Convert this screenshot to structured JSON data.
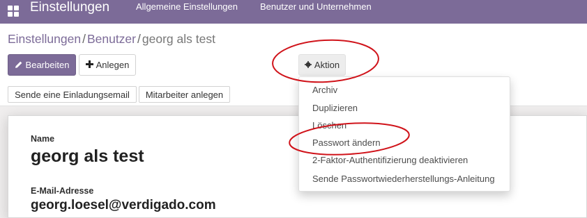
{
  "header": {
    "app_title": "Einstellungen",
    "menu": [
      {
        "label": "Allgemeine Einstellungen"
      },
      {
        "label": "Benutzer und Unternehmen"
      }
    ]
  },
  "breadcrumb": {
    "items": [
      "Einstellungen",
      "Benutzer"
    ],
    "separator": "/",
    "current": "georg als test"
  },
  "toolbar": {
    "edit_label": "Bearbeiten",
    "create_label": "Anlegen",
    "action_label": "Aktion"
  },
  "action_menu": {
    "items": [
      {
        "label": "Archiv"
      },
      {
        "label": "Duplizieren"
      },
      {
        "label": "Löschen"
      },
      {
        "label": "Passwort ändern"
      },
      {
        "label": "2-Faktor-Authentifizierung deaktivieren"
      },
      {
        "label": "Sende Passwortwiederherstellungs-Anleitung"
      }
    ]
  },
  "statusbar": {
    "invite_label": "Sende eine Einladungsemail",
    "employee_label": "Mitarbeiter anlegen"
  },
  "form": {
    "name_label": "Name",
    "name_value": "georg als test",
    "email_label": "E-Mail-Adresse",
    "email_value": "georg.loesel@verdigado.com"
  },
  "icons": {
    "apps": "apps-grid-icon",
    "edit": "pencil-icon",
    "create": "plus-icon",
    "action": "gear-icon"
  },
  "colors": {
    "brand": "#7c6b98",
    "annotation": "#d0131a"
  }
}
